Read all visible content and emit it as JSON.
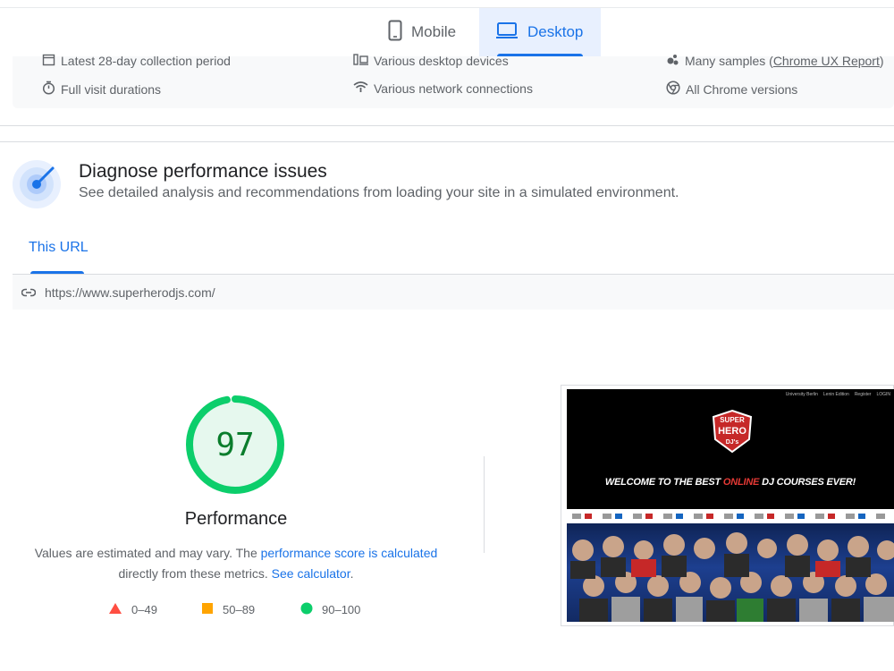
{
  "tabs": {
    "mobile": "Mobile",
    "desktop": "Desktop"
  },
  "field_info": {
    "collection_period": "Latest 28-day collection period",
    "devices": "Various desktop devices",
    "samples_prefix": "Many samples (",
    "samples_link": "Chrome UX Report",
    "samples_suffix": ")",
    "visit_durations": "Full visit durations",
    "network": "Various network connections",
    "chrome_versions": "All Chrome versions"
  },
  "diagnose": {
    "title": "Diagnose performance issues",
    "subtitle": "See detailed analysis and recommendations from loading your site in a simulated environment."
  },
  "url_tab": "This URL",
  "url": "https://www.superherodjs.com/",
  "performance": {
    "score": "97",
    "score_value": 0.97,
    "label": "Performance",
    "note_1": "Values are estimated and may vary. The ",
    "note_link_1": "performance score is calculated",
    "note_2": "directly from these metrics. ",
    "note_link_2": "See calculator",
    "note_3": "."
  },
  "legend": {
    "poor": "0–49",
    "average": "50–89",
    "good": "90–100"
  },
  "colors": {
    "accent": "#1a73e8",
    "good": "#0cce6b",
    "average": "#ffa400",
    "poor": "#ff4e42"
  },
  "thumbnail": {
    "nav": [
      "University Berlin",
      "Lenin Edition",
      "Register",
      "LOGIN"
    ],
    "logo_top": "SUPER",
    "logo_mid": "HERO",
    "logo_bottom": "DJ's",
    "welcome_prefix": "WELCOME TO THE BEST ",
    "welcome_red": "ONLINE",
    "welcome_suffix": " DJ COURSES EVER!"
  }
}
